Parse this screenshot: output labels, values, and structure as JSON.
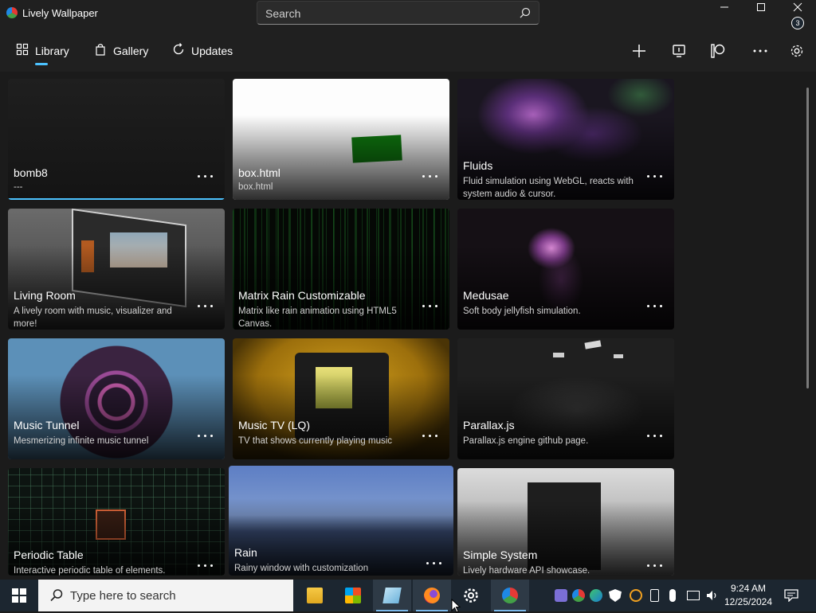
{
  "window": {
    "title": "Lively Wallpaper",
    "search_placeholder": "Search",
    "controls": [
      "minimize",
      "maximize",
      "close"
    ]
  },
  "nav": {
    "tabs": [
      {
        "label": "Library",
        "icon": "library-grid-icon",
        "selected": true
      },
      {
        "label": "Gallery",
        "icon": "gallery-bag-icon",
        "selected": false
      },
      {
        "label": "Updates",
        "icon": "refresh-icon",
        "selected": false
      }
    ],
    "tools": [
      "add-icon",
      "preview-screen-icon",
      "patreon-icon",
      "more-icon",
      "settings-gear-icon"
    ],
    "accent": "#4cc2ff"
  },
  "wallpapers": [
    {
      "title": "bomb8",
      "description": "---",
      "selected": true
    },
    {
      "title": "box.html",
      "description": "box.html"
    },
    {
      "title": "Fluids",
      "description": "Fluid simulation using WebGL, reacts with system audio & cursor."
    },
    {
      "title": "Living Room",
      "description": "A lively room with music, visualizer and more!"
    },
    {
      "title": "Matrix Rain Customizable",
      "description": "Matrix like rain animation using HTML5 Canvas."
    },
    {
      "title": "Medusae",
      "description": "Soft body jellyfish simulation."
    },
    {
      "title": "Music Tunnel",
      "description": "Mesmerizing infinite music tunnel"
    },
    {
      "title": "Music TV (LQ)",
      "description": "TV that shows currently playing music"
    },
    {
      "title": "Parallax.js",
      "description": "Parallax.js engine github page."
    },
    {
      "title": "Periodic Table",
      "description": "Interactive periodic table of elements."
    },
    {
      "title": "Rain",
      "description": "Rainy window with customization"
    },
    {
      "title": "Simple System",
      "description": "Lively hardware API showcase."
    }
  ],
  "taskbar": {
    "search_placeholder": "Type here to search",
    "apps": [
      "file-explorer-icon",
      "microsoft-store-icon",
      "notepad-icon",
      "firefox-icon",
      "settings-icon",
      "lively-wallpaper-icon"
    ],
    "tray_icons": [
      "microphone-app-icon",
      "color-app-icon",
      "edge-icon",
      "shield-icon",
      "search-tool-icon",
      "usb-icon",
      "mic-icon",
      "network-icon",
      "volume-icon"
    ],
    "time": "9:24 AM",
    "date": "12/25/2024",
    "notification_count": "3"
  }
}
